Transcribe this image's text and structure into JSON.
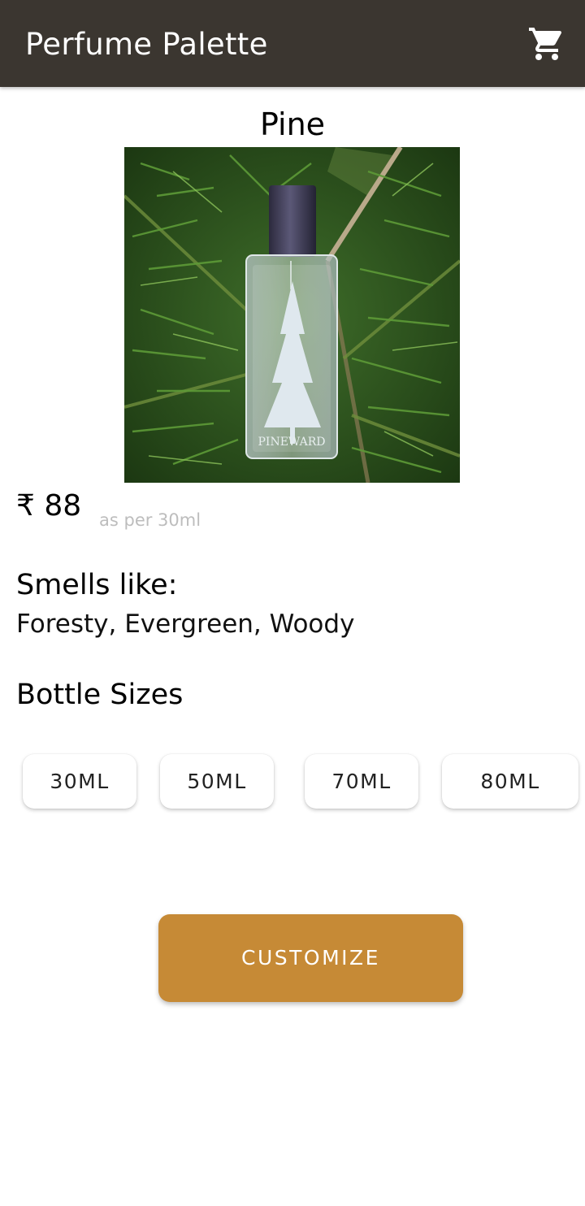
{
  "app_bar": {
    "title": "Perfume Palette",
    "cart_icon": "shopping-cart-icon",
    "background_color": "#3b3630"
  },
  "product": {
    "name": "Pine",
    "image_icon": "perfume-bottle-photo",
    "image_label": "PINEWARD",
    "price": "₹ 88",
    "price_note": "as per 30ml"
  },
  "smells": {
    "heading": "Smells like:",
    "value": "Foresty, Evergreen, Woody"
  },
  "bottle_sizes": {
    "heading": "Bottle Sizes",
    "options": [
      "30ML",
      "50ML",
      "70ML",
      "80ML"
    ]
  },
  "customize": {
    "label": "CUSTOMIZE",
    "color": "#c68a36"
  }
}
